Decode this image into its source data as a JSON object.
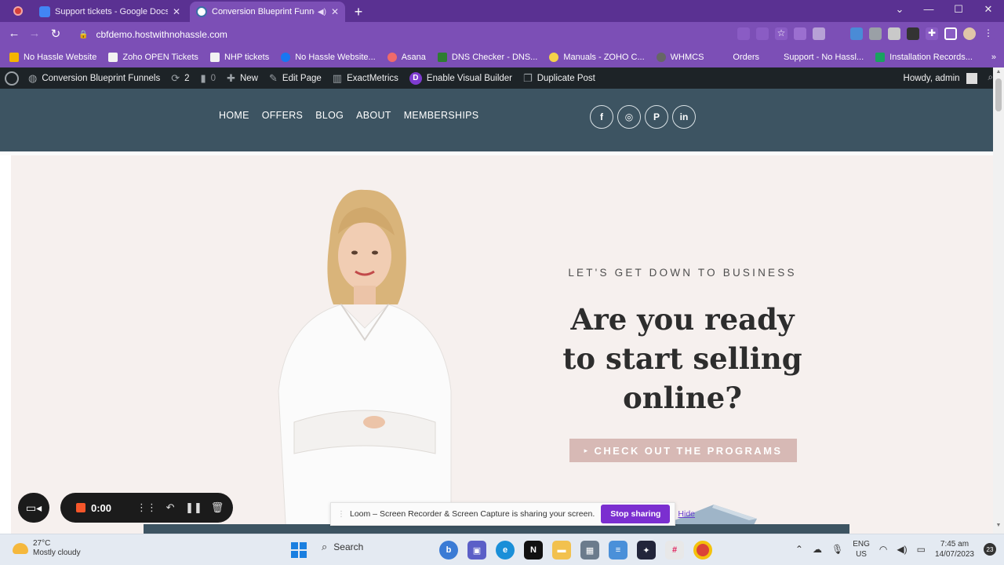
{
  "browser": {
    "tabs": [
      {
        "title": "Support tickets - Google Docs",
        "active": false
      },
      {
        "title": "Conversion Blueprint Funnels",
        "active": true
      }
    ],
    "new_tab": "+",
    "url": "cbfdemo.hostwithnohassle.com",
    "window_controls": {
      "minimize": "—",
      "maximize": "☐",
      "close": "✕",
      "tablist": "⌄"
    }
  },
  "bookmarks": [
    {
      "label": "No Hassle Website",
      "color": "#f5b400"
    },
    {
      "label": "Zoho OPEN Tickets",
      "color": "#f2f2f2"
    },
    {
      "label": "NHP tickets",
      "color": "#f2f2f2"
    },
    {
      "label": "No Hassle Website...",
      "color": "#1877f2"
    },
    {
      "label": "Asana",
      "color": "#f06a6a"
    },
    {
      "label": "DNS Checker - DNS...",
      "color": "#2e7d32"
    },
    {
      "label": "Manuals - ZOHO C...",
      "color": "#f5d24a"
    },
    {
      "label": "WHMCS",
      "color": "#666666"
    },
    {
      "label": "Orders",
      "color": "#7c4fb6"
    },
    {
      "label": "Support - No Hassl...",
      "color": "#7c4fb6"
    },
    {
      "label": "Installation Records...",
      "color": "#1aa260"
    }
  ],
  "adminbar": {
    "site_name": "Conversion Blueprint Funnels",
    "updates_count": "2",
    "comments_count": "0",
    "new_label": "New",
    "edit_label": "Edit Page",
    "metrics_label": "ExactMetrics",
    "builder_label": "Enable Visual Builder",
    "duplicate_label": "Duplicate Post",
    "howdy": "Howdy, admin"
  },
  "site": {
    "menu": [
      "HOME",
      "OFFERS",
      "BLOG",
      "ABOUT",
      "MEMBERSHIPS"
    ],
    "social": [
      {
        "name": "facebook-icon",
        "glyph": "f"
      },
      {
        "name": "instagram-icon",
        "glyph": "◎"
      },
      {
        "name": "pinterest-icon",
        "glyph": "P"
      },
      {
        "name": "linkedin-icon",
        "glyph": "in"
      }
    ],
    "header_color": "#3d5462"
  },
  "hero": {
    "eyebrow": "LET'S GET DOWN TO BUSINESS",
    "headline_line1": "Are you ready",
    "headline_line2": "to start selling",
    "headline_line3": "online?",
    "cta_label": "CHECK OUT THE PROGRAMS",
    "background": "#f6f0ee",
    "cta_color": "#d7b9b5"
  },
  "loom": {
    "time": "0:00",
    "share_text": "Loom – Screen Recorder & Screen Capture is sharing your screen.",
    "stop_label": "Stop sharing",
    "hide_label": "Hide"
  },
  "taskbar": {
    "temperature": "27°C",
    "weather": "Mostly cloudy",
    "search_label": "Search",
    "lang_line1": "ENG",
    "lang_line2": "US",
    "time": "7:45 am",
    "date": "14/07/2023",
    "notifications": "23"
  }
}
